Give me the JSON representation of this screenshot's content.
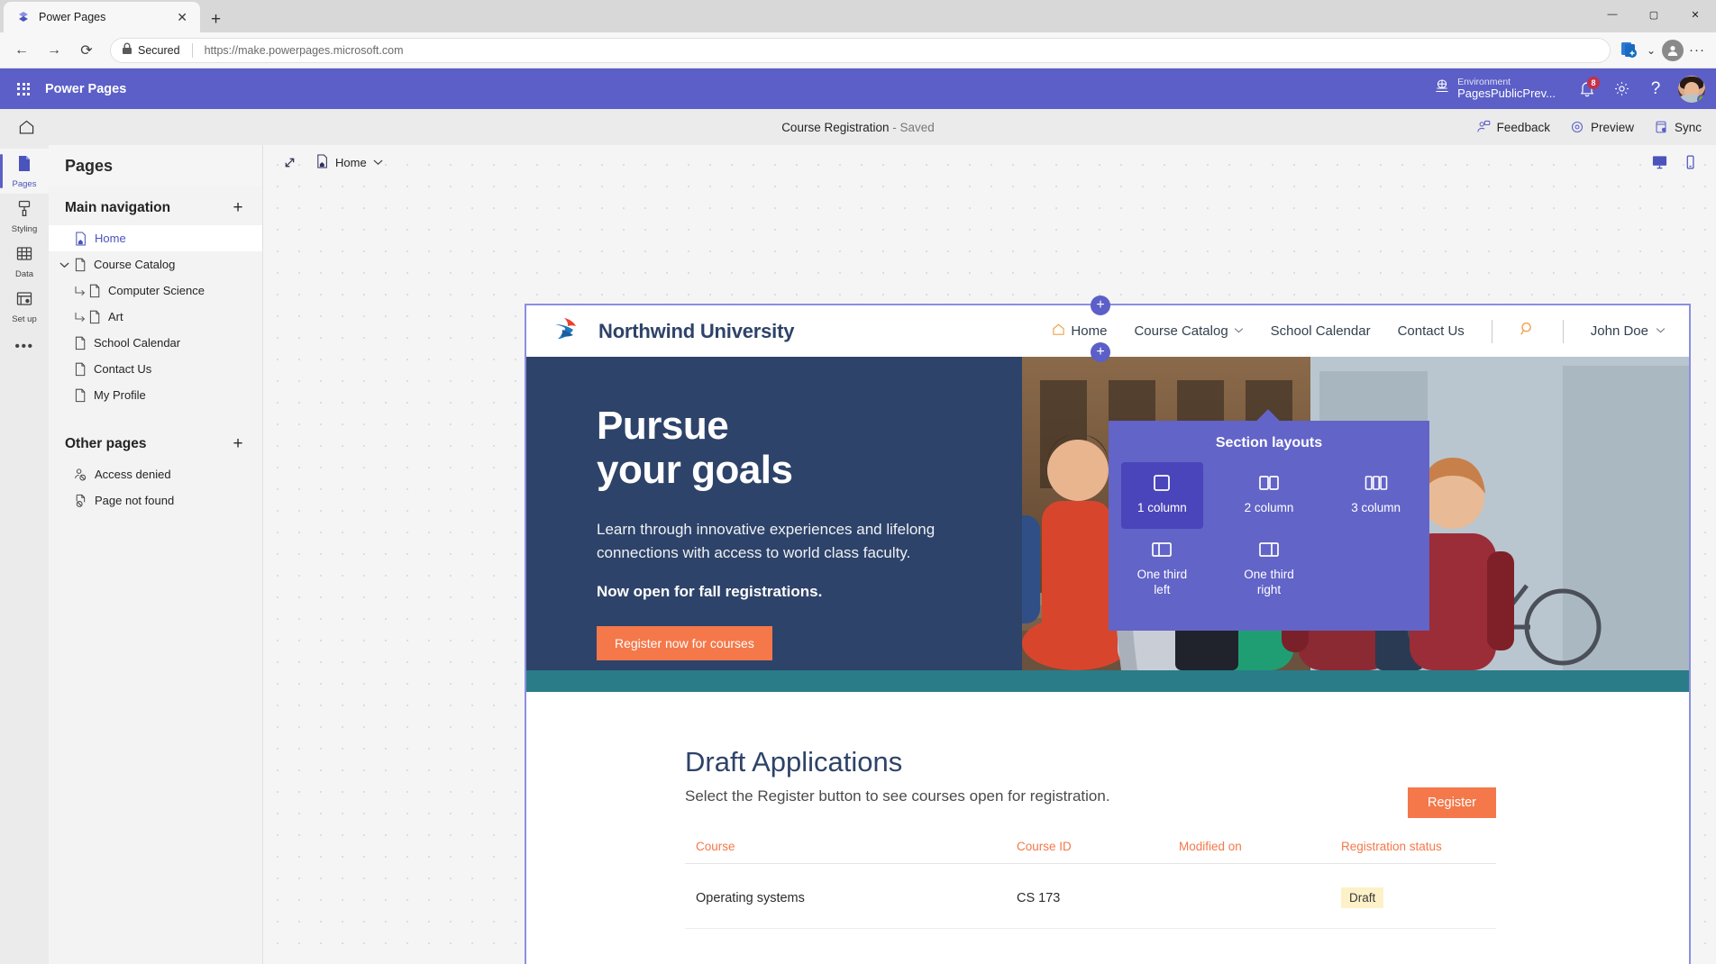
{
  "browser": {
    "tab_title": "Power Pages",
    "tab_close": "✕",
    "new_tab": "+",
    "back": "←",
    "forward": "→",
    "reload": "⟳",
    "secured_label": "Secured",
    "url": "https://make.powerpages.microsoft.com",
    "minimize": "—",
    "maximize": "▢",
    "close": "✕",
    "profile_initial": "",
    "more": "···",
    "collections_caret": "⌄"
  },
  "app_header": {
    "title": "Power Pages",
    "environment_label": "Environment",
    "environment_value": "PagesPublicPrev...",
    "notification_count": "8",
    "help": "?",
    "accent": "#5b5fc7"
  },
  "command_bar": {
    "page_name": "Course Registration",
    "save_state": "- Saved",
    "feedback": "Feedback",
    "preview": "Preview",
    "sync": "Sync"
  },
  "rail": {
    "items": [
      {
        "label": "Pages",
        "icon": "page-icon"
      },
      {
        "label": "Styling",
        "icon": "brush-icon"
      },
      {
        "label": "Data",
        "icon": "table-icon"
      },
      {
        "label": "Set up",
        "icon": "setup-icon"
      }
    ],
    "more": "•••"
  },
  "panel": {
    "title": "Pages",
    "main_nav": {
      "title": "Main navigation",
      "add": "+",
      "items": [
        {
          "label": "Home",
          "selected": true,
          "child": false,
          "expandable": false
        },
        {
          "label": "Course Catalog",
          "selected": false,
          "child": false,
          "expandable": true
        },
        {
          "label": "Computer Science",
          "selected": false,
          "child": true,
          "expandable": false
        },
        {
          "label": "Art",
          "selected": false,
          "child": true,
          "expandable": false
        },
        {
          "label": "School Calendar",
          "selected": false,
          "child": false,
          "expandable": false
        },
        {
          "label": "Contact Us",
          "selected": false,
          "child": false,
          "expandable": false
        },
        {
          "label": "My Profile",
          "selected": false,
          "child": false,
          "expandable": false
        }
      ]
    },
    "other_pages": {
      "title": "Other pages",
      "add": "+",
      "items": [
        {
          "label": "Access denied",
          "icon": "access-denied-icon"
        },
        {
          "label": "Page not found",
          "icon": "page-not-found-icon"
        }
      ]
    }
  },
  "canvas_toolbar": {
    "expand": "↘",
    "page_label": "Home",
    "page_caret": "⌄",
    "desktop_view": "desktop-icon",
    "mobile_view": "mobile-icon"
  },
  "section_layouts": {
    "title": "Section layouts",
    "options": [
      {
        "label": "1 column",
        "selected": true
      },
      {
        "label": "2 column",
        "selected": false
      },
      {
        "label": "3 column",
        "selected": false
      },
      {
        "label": "One third\nleft",
        "selected": false
      },
      {
        "label": "One third\nright",
        "selected": false
      }
    ],
    "add_symbol": "+"
  },
  "site": {
    "brand": "Northwind University",
    "nav": [
      {
        "label": "Home",
        "caret": false,
        "home_icon": true
      },
      {
        "label": "Course Catalog",
        "caret": true,
        "home_icon": false
      },
      {
        "label": "School Calendar",
        "caret": false,
        "home_icon": false
      },
      {
        "label": "Contact Us",
        "caret": false,
        "home_icon": false
      }
    ],
    "user": "John Doe",
    "user_caret": "⌄",
    "hero": {
      "heading_line1": "Pursue",
      "heading_line2": "your goals",
      "paragraph": "Learn through innovative experiences and lifelong connections with access to world class faculty.",
      "emphasis": "Now open for fall registrations.",
      "cta": "Register now for courses"
    },
    "section": {
      "heading": "Draft Applications",
      "subtext": "Select the Register button to see courses open for registration.",
      "register_button": "Register",
      "columns": [
        "Course",
        "Course ID",
        "Modified on",
        "Registration status"
      ],
      "rows": [
        {
          "course": "Operating systems",
          "course_id": "CS 173",
          "modified_on": "",
          "status": "Draft"
        }
      ]
    },
    "colors": {
      "hero_bg": "#2e4369",
      "accent_orange": "#f4784a",
      "teal_band": "#2a7c89",
      "chip_bg": "#fdf1c8"
    }
  }
}
